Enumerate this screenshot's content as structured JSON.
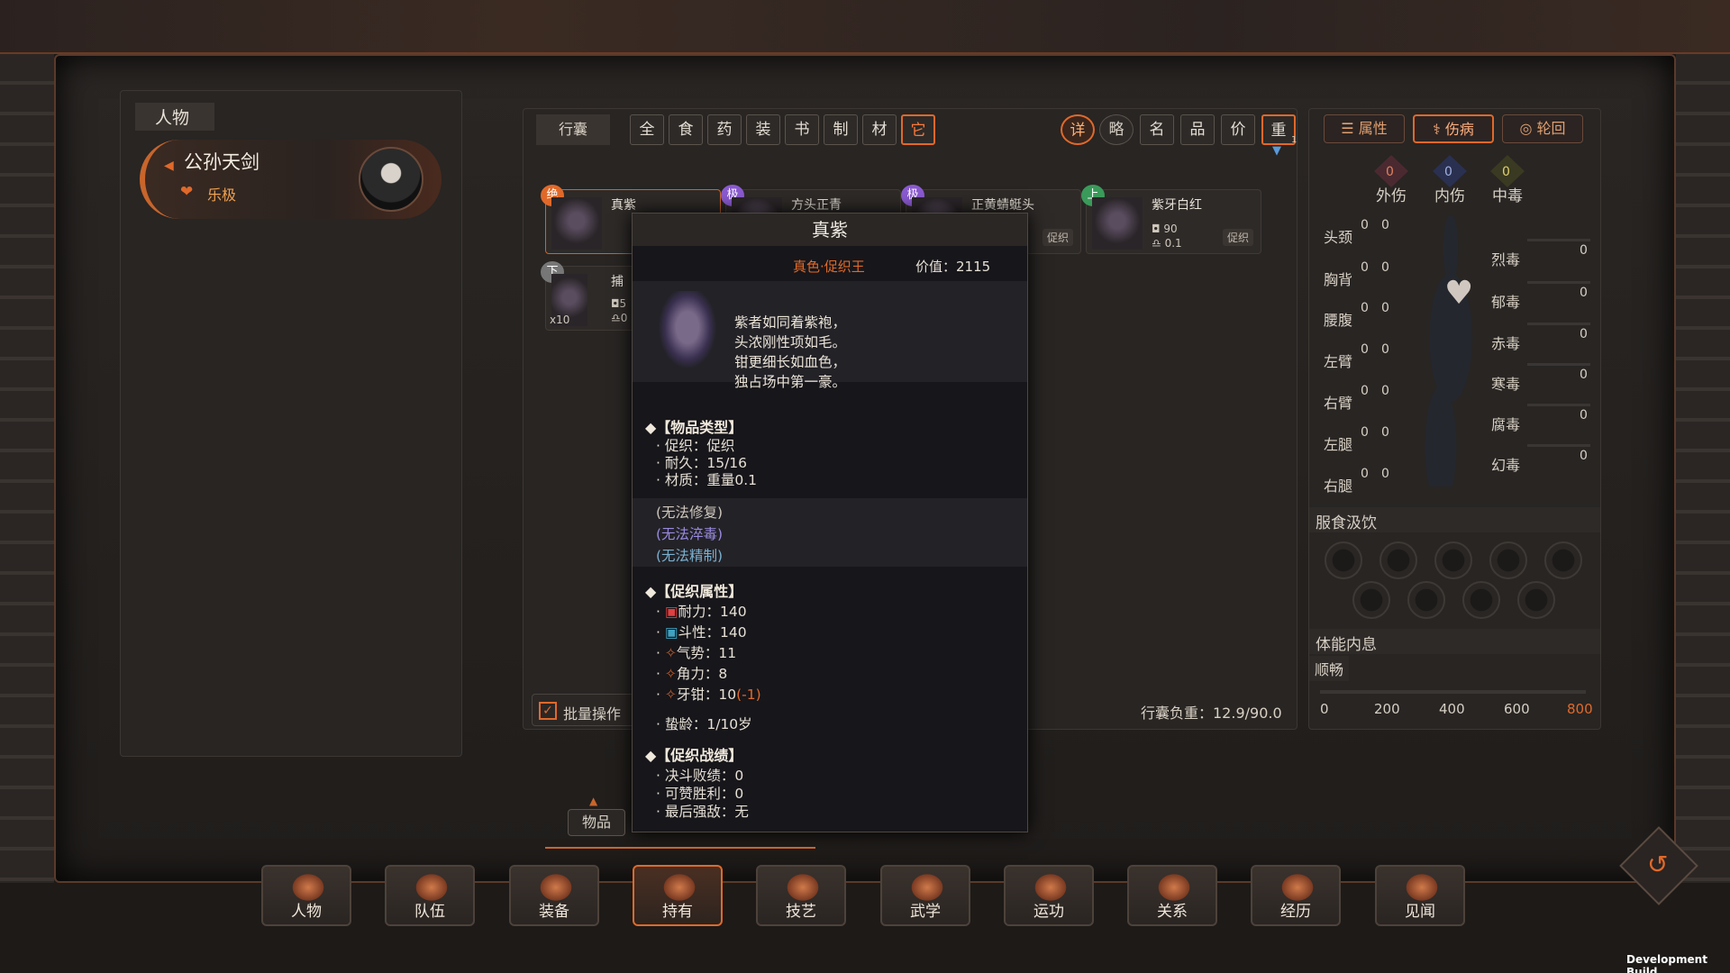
{
  "left_panel": {
    "title": "人物",
    "char_name": "公孙天剑",
    "mood": "乐极"
  },
  "bag": {
    "label": "行囊",
    "filters": [
      "全",
      "食",
      "药",
      "装",
      "书",
      "制",
      "材",
      "它"
    ],
    "sorts": [
      "详",
      "略",
      "名",
      "品",
      "价",
      "重"
    ],
    "sort_badge": "1"
  },
  "items": [
    {
      "grade": "绝",
      "grade_color": "#e0692a",
      "name": "真紫"
    },
    {
      "grade": "极",
      "grade_color": "#8a5ad0",
      "name": "方头正青"
    },
    {
      "grade": "极",
      "grade_color": "#8a5ad0",
      "name": "正黄蜻蜓头",
      "tag": "促织"
    },
    {
      "grade": "上",
      "grade_color": "#3a9a5a",
      "name": "紫牙白红",
      "value": "90",
      "weight": "0.1",
      "tag": "促织"
    },
    {
      "grade": "下",
      "grade_color": "#888",
      "name": "捕",
      "count": "x10",
      "value": "5",
      "weight": "0"
    }
  ],
  "batch_label": "批量操作",
  "bag_weight": "行囊负重：12.9/90.0",
  "tooltip": {
    "title": "真紫",
    "subtitle": "真色·促织王",
    "value": "价值：2115",
    "poem": [
      "紫者如同着紫袍，",
      "头浓刚性项如毛。",
      "钳更细长如血色，",
      "独占场中第一豪。"
    ],
    "sec_type": "◆【物品类型】",
    "type_rows": [
      "促织：促织",
      "耐久：15/16",
      "材质：重量0.1"
    ],
    "flags": [
      "(无法修复)",
      "(无法淬毒)",
      "(无法精制)"
    ],
    "sec_attr": "◆【促织属性】",
    "attr_rows": [
      {
        "k": "耐力：",
        "v": "140"
      },
      {
        "k": "斗性：",
        "v": "140"
      },
      {
        "k": "气势：",
        "v": "11"
      },
      {
        "k": "角力：",
        "v": "8"
      },
      {
        "k": "牙钳：",
        "v": "10"
      }
    ],
    "attr_penalty": "(-1)",
    "age": "蛰龄：1/10岁",
    "sec_battle": "◆【促织战绩】",
    "battle_rows": [
      "决斗败绩：0",
      "可赞胜利：0",
      "最后强敌：无"
    ]
  },
  "right": {
    "tabs": [
      "属性",
      "伤病",
      "轮回"
    ],
    "wounds": [
      {
        "label": "外伤",
        "v": "0"
      },
      {
        "label": "内伤",
        "v": "0"
      },
      {
        "label": "中毒",
        "v": "0"
      }
    ],
    "body_parts": [
      "头颈",
      "胸背",
      "腰腹",
      "左臂",
      "右臂",
      "左腿",
      "右腿"
    ],
    "body_val": "0",
    "poisons": [
      {
        "label": "烈毒",
        "v": "0"
      },
      {
        "label": "郁毒",
        "v": "0"
      },
      {
        "label": "赤毒",
        "v": "0"
      },
      {
        "label": "寒毒",
        "v": "0"
      },
      {
        "label": "腐毒",
        "v": "0"
      },
      {
        "label": "幻毒",
        "v": "0"
      }
    ],
    "food_title": "服食汲饮",
    "stamina_title": "体能内息",
    "stamina_state": "顺畅",
    "scale": [
      "0",
      "200",
      "400",
      "600",
      "800"
    ]
  },
  "collapse_label": "物品",
  "nav": [
    "人物",
    "队伍",
    "装备",
    "持有",
    "技艺",
    "武学",
    "运功",
    "关系",
    "经历",
    "见闻"
  ],
  "nav_active": 3,
  "dev": "Development Build"
}
